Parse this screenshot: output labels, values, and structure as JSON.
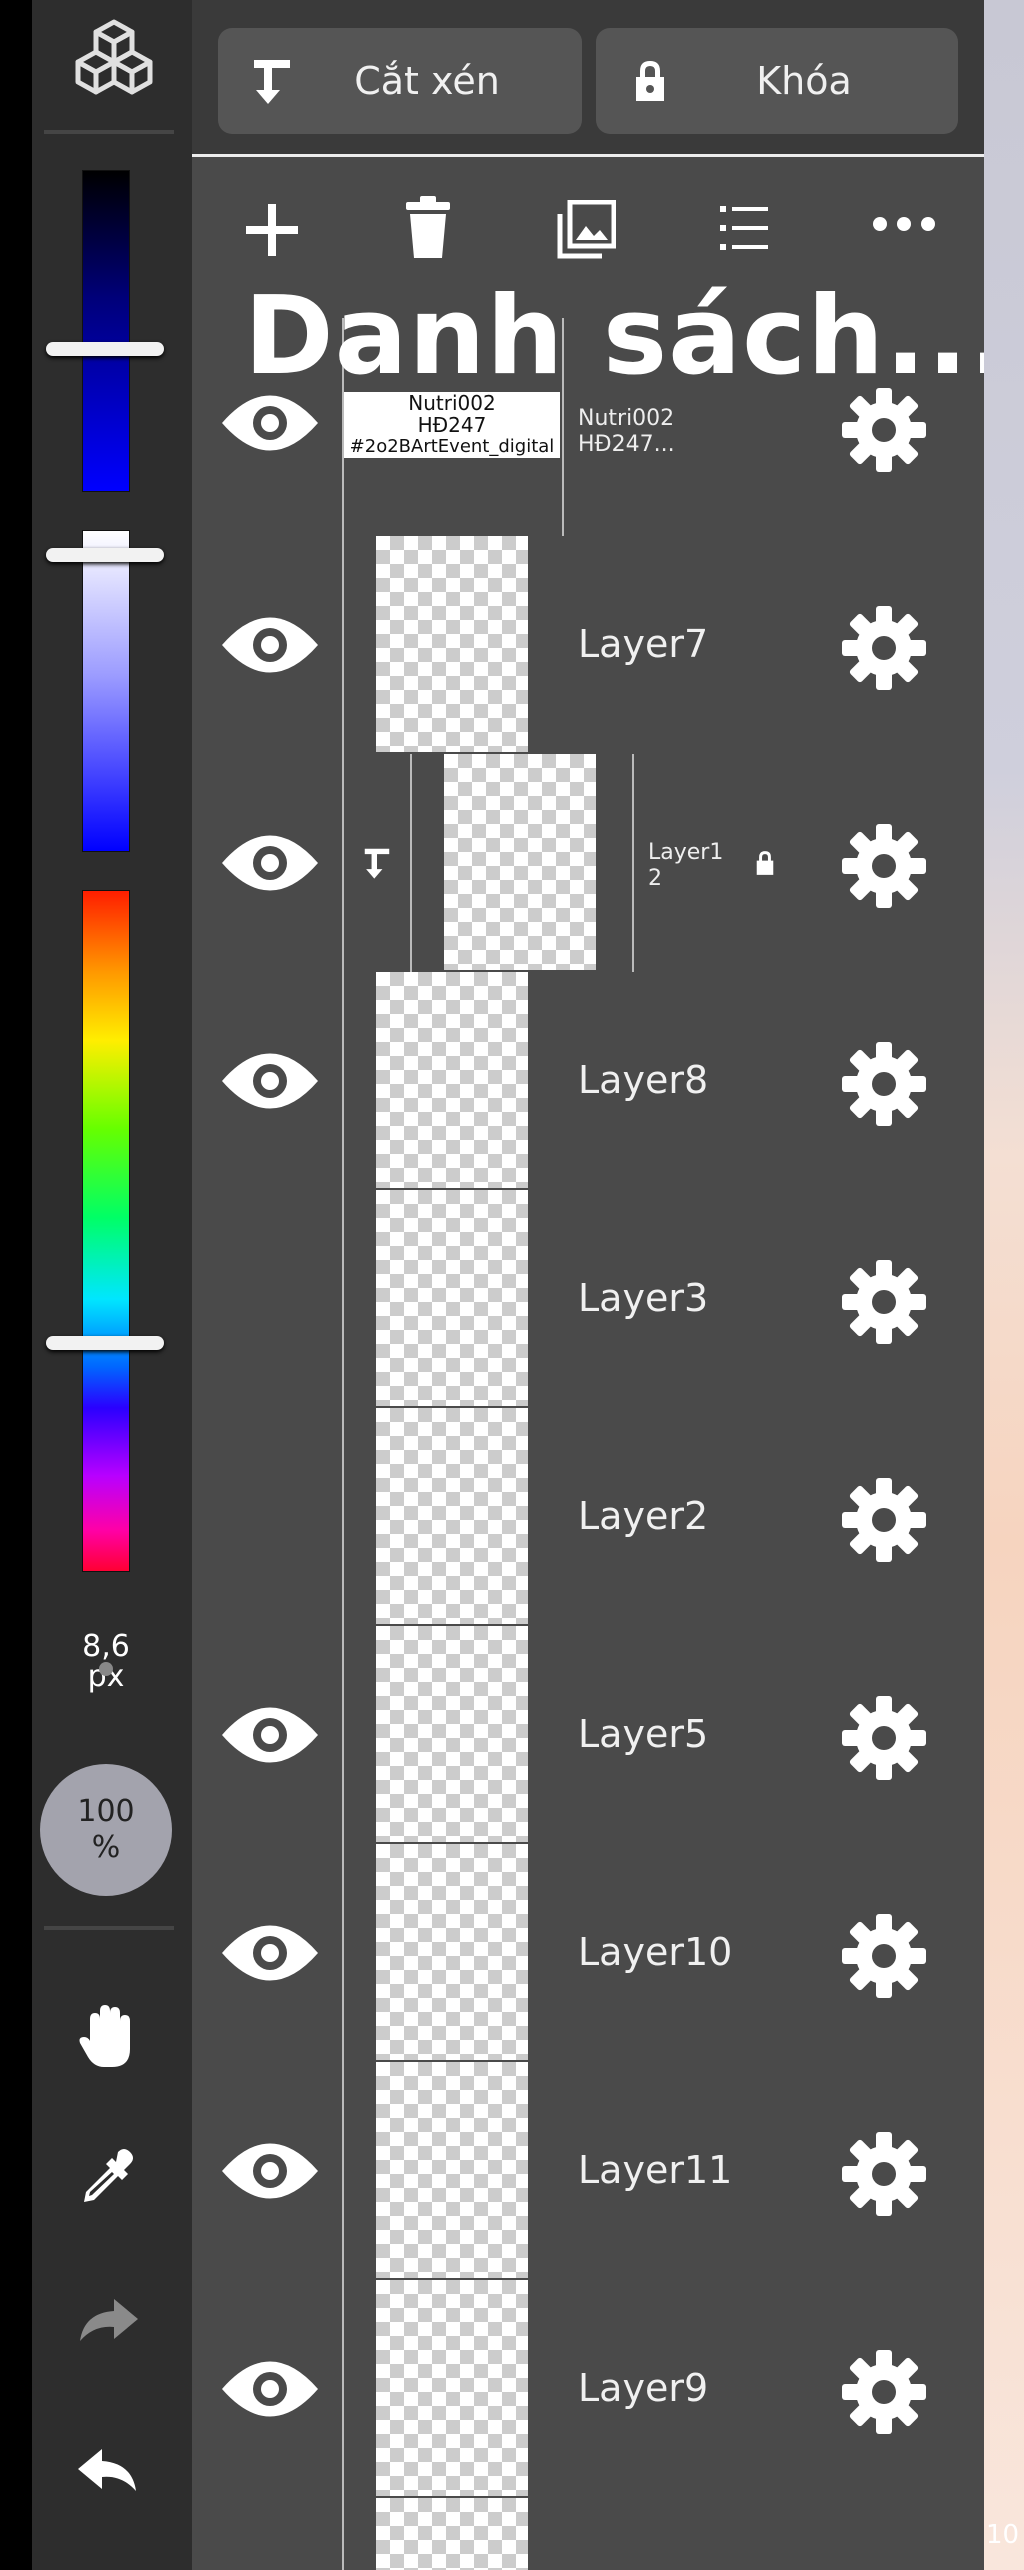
{
  "topbar": {
    "crop_label": "Cắt xén",
    "lock_label": "Khóa"
  },
  "panel_title": "Danh sách...",
  "brush": {
    "size_value": "8,6",
    "size_unit": "px",
    "opacity_value": "100",
    "opacity_unit": "%"
  },
  "layers": [
    {
      "name": "Nutri002 HĐ247...",
      "visible": true,
      "thumb_text": [
        "Nutri002",
        "HĐ247",
        "#2o2BArtEvent_digital"
      ]
    },
    {
      "name": "Layer7",
      "visible": true
    },
    {
      "name": "Layer1 2",
      "visible": true,
      "clipped": true,
      "locked": true
    },
    {
      "name": "Layer8",
      "visible": true
    },
    {
      "name": "Layer3",
      "visible": false
    },
    {
      "name": "Layer2",
      "visible": false
    },
    {
      "name": "Layer5",
      "visible": true
    },
    {
      "name": "Layer10",
      "visible": true
    },
    {
      "name": "Layer11",
      "visible": true
    },
    {
      "name": "Layer9",
      "visible": true
    }
  ],
  "layer0": {
    "name_line1": "Nutri002",
    "name_line2": "HĐ247...",
    "thumb_line1": "Nutri002",
    "thumb_line2": "HĐ247",
    "thumb_line3": "#2o2BArtEvent_digital"
  },
  "layer1": {
    "name": "Layer7"
  },
  "layer2": {
    "name_line1": "Layer1",
    "name_line2": "2"
  },
  "layer3": {
    "name": "Layer8"
  },
  "layer4": {
    "name": "Layer3"
  },
  "layer5": {
    "name": "Layer2"
  },
  "layer6": {
    "name": "Layer5"
  },
  "layer7": {
    "name": "Layer10"
  },
  "layer8": {
    "name": "Layer11"
  },
  "layer9": {
    "name": "Layer9"
  },
  "canvas": {
    "zoom_text": "10"
  },
  "icons": [
    "cube-icon",
    "clip-arrow-icon",
    "lock-icon",
    "plus-icon",
    "trash-icon",
    "image-icon",
    "list-icon",
    "more-icon",
    "eye-icon",
    "gear-icon",
    "hand-icon",
    "eyedropper-icon",
    "redo-icon",
    "undo-icon"
  ],
  "colors": {
    "panel": "#4a4a4a",
    "toolbar": "#2d2d2d",
    "button": "#555555"
  }
}
